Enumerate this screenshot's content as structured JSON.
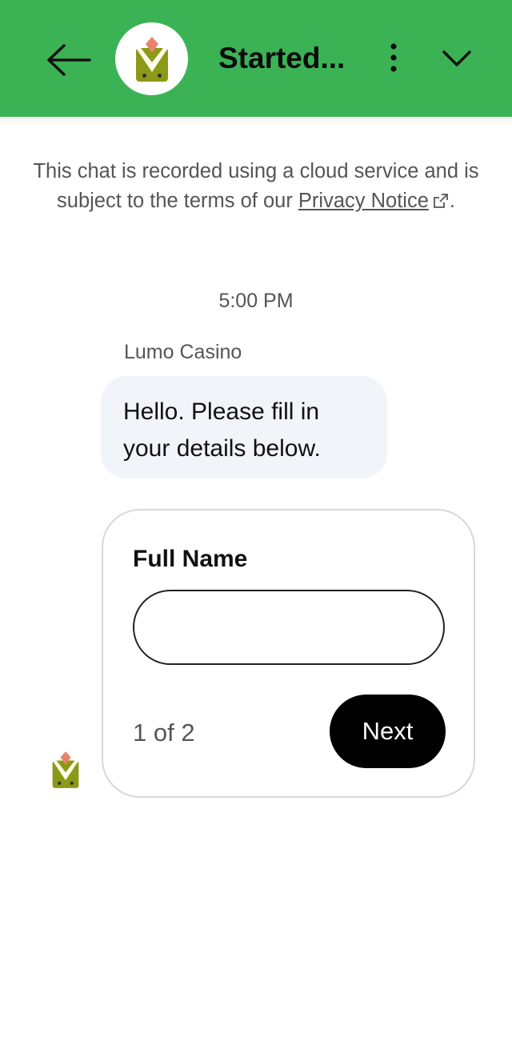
{
  "header": {
    "title": "Started...",
    "brand_color": "#3bb355",
    "back_icon": "arrow-left-icon",
    "menu_icon": "more-vertical-icon",
    "collapse_icon": "chevron-down-icon"
  },
  "notice": {
    "text_before": "This chat is recorded using a cloud service and is subject to the terms of our ",
    "link_text": "Privacy Notice",
    "text_after": ".",
    "link_icon": "external-link-icon"
  },
  "conversation": {
    "timestamp": "5:00 PM",
    "sender_name": "Lumo Casino",
    "message": "Hello. Please fill in your details below."
  },
  "form": {
    "field_label": "Full Name",
    "field_value": "",
    "step_text": "1 of 2",
    "next_label": "Next"
  }
}
